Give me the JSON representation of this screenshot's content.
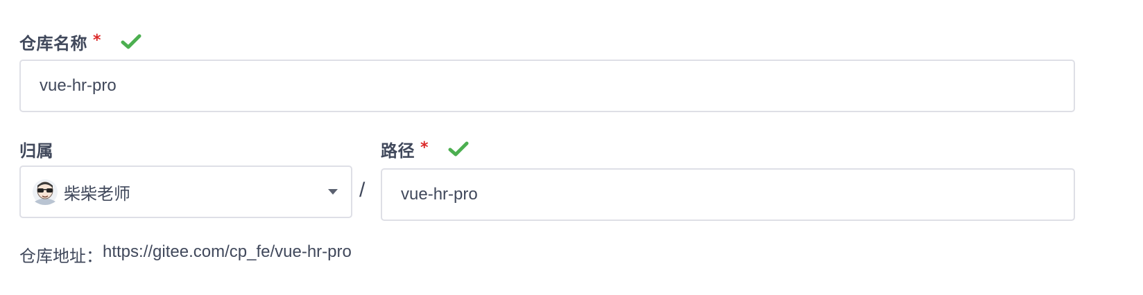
{
  "repo_name": {
    "label": "仓库名称",
    "required_mark": "*",
    "value": "vue-hr-pro",
    "valid_icon": "check-icon"
  },
  "owner": {
    "label": "归属",
    "selected": "柴柴老师",
    "avatar_icon": "avatar"
  },
  "separator": "/",
  "path": {
    "label": "路径",
    "required_mark": "*",
    "value": "vue-hr-pro",
    "valid_icon": "check-icon"
  },
  "address": {
    "label": "仓库地址：",
    "url": "https://gitee.com/cp_fe/vue-hr-pro"
  },
  "colors": {
    "text": "#40485b",
    "required": "#db2828",
    "valid": "#4caf50",
    "border": "#dedfe6"
  }
}
